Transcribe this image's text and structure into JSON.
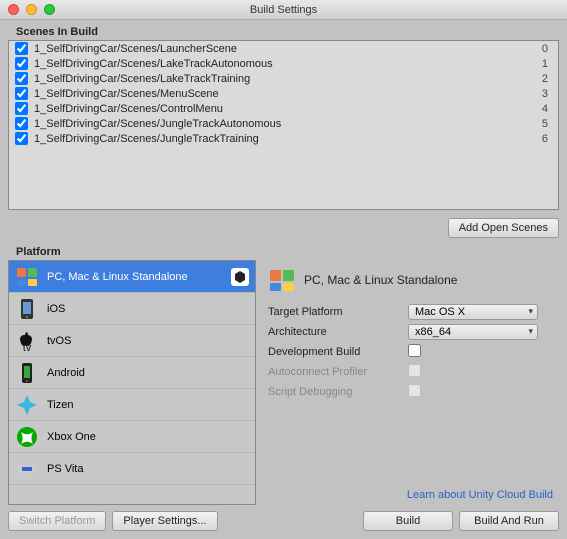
{
  "window": {
    "title": "Build Settings"
  },
  "scenes": {
    "label": "Scenes In Build",
    "items": [
      {
        "checked": true,
        "path": "1_SelfDrivingCar/Scenes/LauncherScene",
        "index": "0"
      },
      {
        "checked": true,
        "path": "1_SelfDrivingCar/Scenes/LakeTrackAutonomous",
        "index": "1"
      },
      {
        "checked": true,
        "path": "1_SelfDrivingCar/Scenes/LakeTrackTraining",
        "index": "2"
      },
      {
        "checked": true,
        "path": "1_SelfDrivingCar/Scenes/MenuScene",
        "index": "3"
      },
      {
        "checked": true,
        "path": "1_SelfDrivingCar/Scenes/ControlMenu",
        "index": "4"
      },
      {
        "checked": true,
        "path": "1_SelfDrivingCar/Scenes/JungleTrackAutonomous",
        "index": "5"
      },
      {
        "checked": true,
        "path": "1_SelfDrivingCar/Scenes/JungleTrackTraining",
        "index": "6"
      }
    ],
    "add_button": "Add Open Scenes"
  },
  "platform": {
    "label": "Platform",
    "items": [
      {
        "name": "PC, Mac & Linux Standalone",
        "selected": true,
        "icon": "standalone"
      },
      {
        "name": "iOS",
        "selected": false,
        "icon": "ios"
      },
      {
        "name": "tvOS",
        "selected": false,
        "icon": "tvos"
      },
      {
        "name": "Android",
        "selected": false,
        "icon": "android"
      },
      {
        "name": "Tizen",
        "selected": false,
        "icon": "tizen"
      },
      {
        "name": "Xbox One",
        "selected": false,
        "icon": "xbox"
      },
      {
        "name": "PS Vita",
        "selected": false,
        "icon": "psvita"
      }
    ]
  },
  "detail": {
    "title": "PC, Mac & Linux Standalone",
    "rows": {
      "target_platform": {
        "label": "Target Platform",
        "value": "Mac OS X"
      },
      "architecture": {
        "label": "Architecture",
        "value": "x86_64"
      },
      "dev_build": {
        "label": "Development Build",
        "checked": false
      },
      "autoconnect": {
        "label": "Autoconnect Profiler",
        "checked": false,
        "disabled": true
      },
      "script_debug": {
        "label": "Script Debugging",
        "checked": false,
        "disabled": true
      }
    },
    "link": "Learn about Unity Cloud Build"
  },
  "footer": {
    "switch_platform": "Switch Platform",
    "player_settings": "Player Settings...",
    "build": "Build",
    "build_and_run": "Build And Run"
  }
}
